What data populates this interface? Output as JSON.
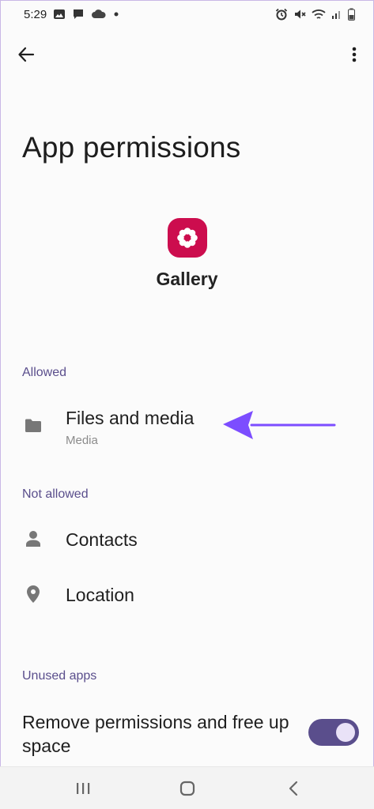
{
  "status_bar": {
    "time": "5:29",
    "left_icons": [
      "gallery-notification-icon",
      "message-icon",
      "cloud-icon",
      "dot-icon"
    ],
    "right_icons": [
      "alarm-icon",
      "mute-icon",
      "wifi-icon",
      "signal-icon",
      "battery-icon"
    ]
  },
  "top_bar": {
    "back_icon": "arrow-back-icon",
    "more_icon": "more-vert-icon"
  },
  "page": {
    "title": "App permissions",
    "app_name": "Gallery",
    "app_icon_color": "#cc0d4e"
  },
  "sections": {
    "allowed": {
      "header": "Allowed",
      "items": [
        {
          "title": "Files and media",
          "subtitle": "Media",
          "icon": "folder-icon"
        }
      ]
    },
    "not_allowed": {
      "header": "Not allowed",
      "items": [
        {
          "title": "Contacts",
          "icon": "person-icon"
        },
        {
          "title": "Location",
          "icon": "location-icon"
        }
      ]
    },
    "unused_apps": {
      "header": "Unused apps",
      "toggle_label": "Remove permissions and free up space",
      "toggle_on": true
    }
  },
  "annotation": {
    "color": "#7c4dff",
    "icon": "arrow-left-annotation"
  },
  "colors": {
    "accent": "#5a4e8c",
    "background": "#fbfbfb"
  },
  "nav_bar": {
    "buttons": [
      "recents-icon",
      "home-icon",
      "back-nav-icon"
    ]
  }
}
